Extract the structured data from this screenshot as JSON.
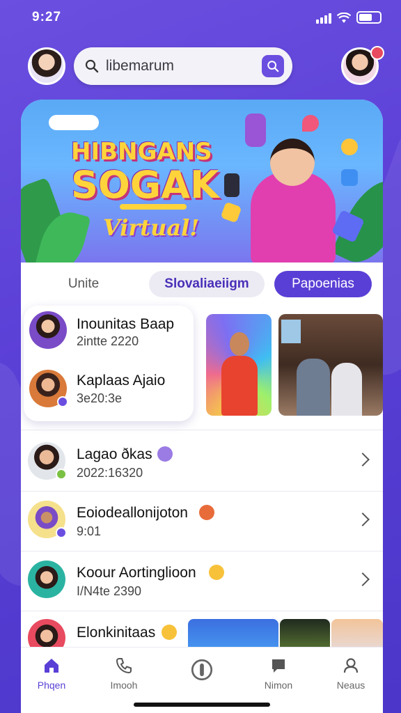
{
  "status_bar": {
    "time": "9:27"
  },
  "search": {
    "placeholder": "libemarum"
  },
  "banner": {
    "title_line1": "HIBNGANS",
    "title_line2": "SOGAK",
    "subtitle": "Virtual!"
  },
  "tabs": [
    {
      "label": "Unite",
      "state": "plain"
    },
    {
      "label": "Slovaliaeiigm",
      "state": "soft"
    },
    {
      "label": "Papoenias",
      "state": "active"
    }
  ],
  "group_card": {
    "items": [
      {
        "title": "Inounitas Baap",
        "subtitle": "2intte 2220"
      },
      {
        "title": "Kaplaas Ajaio",
        "subtitle": "3e20:3e"
      }
    ]
  },
  "list": [
    {
      "title": "Lagao ðkas",
      "subtitle": "2022:16320"
    },
    {
      "title": "Eoiodeallonijoton",
      "subtitle": "9:01"
    },
    {
      "title": "Koour Aortinglioon",
      "subtitle": "I/N4te 2390"
    },
    {
      "title": "Elonkinitaas",
      "subtitle": ""
    }
  ],
  "bottom_nav": [
    {
      "label": "Phqen",
      "icon": "home-icon",
      "active": true
    },
    {
      "label": "Imooh",
      "icon": "phone-icon",
      "active": false
    },
    {
      "label": "",
      "icon": "center-action-icon",
      "active": false
    },
    {
      "label": "Nimon",
      "icon": "chat-icon",
      "active": false
    },
    {
      "label": "Neaus",
      "icon": "profile-icon",
      "active": false
    }
  ],
  "colors": {
    "accent": "#5a3fd6",
    "background": "#6b4fe0"
  }
}
